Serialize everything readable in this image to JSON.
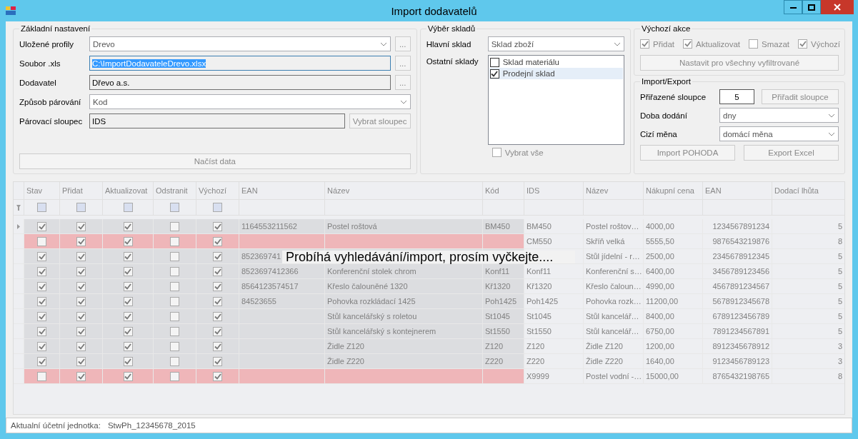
{
  "window": {
    "title": "Import dodavatelů"
  },
  "basic_settings": {
    "title": "Základní nastavení",
    "fields": [
      {
        "kind": "combo",
        "label": "Uložené profily",
        "value": "Drevo",
        "browse": "..."
      },
      {
        "kind": "text",
        "label": "Soubor .xls",
        "value": "C:\\ImportDodavateleDrevo.xlsx",
        "selected": true,
        "browse": "..."
      },
      {
        "kind": "text",
        "label": "Dodavatel",
        "value": "Dřevo a.s.",
        "selected": false,
        "browse": "..."
      },
      {
        "kind": "combo",
        "label": "Způsob párování",
        "value": "Kod"
      },
      {
        "kind": "text",
        "label": "Párovací sloupec",
        "value": "IDS",
        "selected": false,
        "button": "Vybrat sloupec"
      }
    ],
    "load_button": "Načíst data"
  },
  "warehouses": {
    "title": "Výběr skladů",
    "main_label": "Hlavní sklad",
    "main_value": "Sklad zboží",
    "other_label": "Ostatní sklady",
    "items": [
      {
        "label": "Sklad materiálu",
        "checked": false,
        "selected": false
      },
      {
        "label": "Prodejní sklad",
        "checked": true,
        "selected": true
      }
    ],
    "select_all": {
      "label": "Vybrat vše",
      "checked": false
    }
  },
  "default_actions": {
    "title": "Výchozí akce",
    "options": [
      {
        "label": "Přidat",
        "checked": true
      },
      {
        "label": "Aktualizovat",
        "checked": true
      },
      {
        "label": "Smazat",
        "checked": false
      },
      {
        "label": "Výchozí",
        "checked": true
      }
    ],
    "button": "Nastavit pro všechny vyfiltrované"
  },
  "import_export": {
    "title": "Import/Export",
    "assigned_label": "Přiřazené sloupce",
    "assigned_value": "5",
    "assign_button": "Přiřadit sloupce",
    "delivery_label": "Doba dodání",
    "delivery_value": "dny",
    "currency_label": "Cizí měna",
    "currency_value": "domácí měna",
    "buttons": [
      "Import POHODA",
      "Export Excel"
    ]
  },
  "table": {
    "check_columns": [
      "Stav",
      "Přidat",
      "Aktualizovat",
      "Odstranit",
      "Výchozí"
    ],
    "columns": [
      "EAN",
      "Název",
      "Kód",
      "IDS",
      "Název",
      "Nákupní cena",
      "EAN",
      "Dodací lhůta"
    ],
    "filter_checks": [
      false,
      false,
      false,
      false,
      false
    ],
    "rows": [
      {
        "current": true,
        "error": false,
        "checks": [
          true,
          true,
          true,
          false,
          true
        ],
        "cells": [
          "1164553211562",
          "Postel roštová",
          "BM450",
          "BM450",
          "Postel roštov…",
          "4000,00",
          "1234567891234",
          "5"
        ]
      },
      {
        "current": false,
        "error": true,
        "checks": [
          false,
          true,
          true,
          false,
          true
        ],
        "cells": [
          null,
          null,
          null,
          "CM550",
          "Skříň velká",
          "5555,50",
          "9876543219876",
          "8"
        ]
      },
      {
        "current": false,
        "error": false,
        "checks": [
          true,
          true,
          true,
          false,
          true
        ],
        "cells": [
          "852369741",
          null,
          null,
          null,
          "Stůl jídelní - r…",
          "2500,00",
          "2345678912345",
          "5"
        ]
      },
      {
        "current": false,
        "error": false,
        "checks": [
          true,
          true,
          true,
          false,
          true
        ],
        "cells": [
          "8523697412366",
          "Konferenční stolek chrom",
          "Konf11",
          "Konf11",
          "Konferenční s…",
          "6400,00",
          "3456789123456",
          "5"
        ]
      },
      {
        "current": false,
        "error": false,
        "checks": [
          true,
          true,
          true,
          false,
          true
        ],
        "cells": [
          "8564123574517",
          "Křeslo čalouněné 1320",
          "Kř1320",
          "Kř1320",
          "Křeslo čaloun…",
          "4990,00",
          "4567891234567",
          "5"
        ]
      },
      {
        "current": false,
        "error": false,
        "checks": [
          true,
          true,
          true,
          false,
          true
        ],
        "cells": [
          "84523655",
          "Pohovka rozkládací 1425",
          "Poh1425",
          "Poh1425",
          "Pohovka rozk…",
          "11200,00",
          "5678912345678",
          "5"
        ]
      },
      {
        "current": false,
        "error": false,
        "checks": [
          true,
          true,
          true,
          false,
          true
        ],
        "cells": [
          null,
          "Stůl kancelářský s roletou",
          "St1045",
          "St1045",
          "Stůl kancelář…",
          "8400,00",
          "6789123456789",
          "5"
        ]
      },
      {
        "current": false,
        "error": false,
        "checks": [
          true,
          true,
          true,
          false,
          true
        ],
        "cells": [
          null,
          "Stůl kancelářský s kontejnerem",
          "St1550",
          "St1550",
          "Stůl kancelář…",
          "6750,00",
          "7891234567891",
          "5"
        ]
      },
      {
        "current": false,
        "error": false,
        "checks": [
          true,
          true,
          true,
          false,
          true
        ],
        "cells": [
          null,
          "Židle Z120",
          "Z120",
          "Z120",
          "Židle Z120",
          "1200,00",
          "8912345678912",
          "3"
        ]
      },
      {
        "current": false,
        "error": false,
        "checks": [
          true,
          true,
          true,
          false,
          true
        ],
        "cells": [
          null,
          "Židle Z220",
          "Z220",
          "Z220",
          "Židle Z220",
          "1640,00",
          "9123456789123",
          "3"
        ]
      },
      {
        "current": false,
        "error": true,
        "checks": [
          false,
          true,
          true,
          false,
          true
        ],
        "cells": [
          null,
          null,
          null,
          "X9999",
          "Postel vodní -…",
          "15000,00",
          "8765432198765",
          "8"
        ]
      }
    ],
    "overlay": "Probíhá vyhledávání/import, prosím vyčkejte...."
  },
  "status_bar": {
    "label": "Aktualní účetní jednotka:",
    "value": "StwPh_12345678_2015"
  }
}
